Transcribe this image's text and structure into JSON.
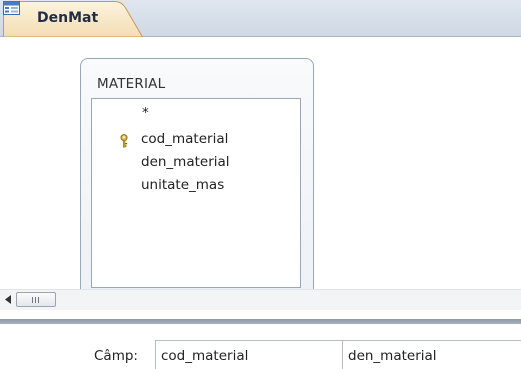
{
  "tab": {
    "label": "DenMat",
    "icon": "query-design-icon"
  },
  "field_list": {
    "title": "MATERIAL",
    "fields": [
      {
        "name": "*",
        "primary_key": false
      },
      {
        "name": "cod_material",
        "primary_key": true
      },
      {
        "name": "den_material",
        "primary_key": false
      },
      {
        "name": "unitate_mas",
        "primary_key": false
      }
    ]
  },
  "grid": {
    "row_label": "Câmp:",
    "columns": [
      "cod_material",
      "den_material"
    ]
  },
  "colors": {
    "tab_fill": "#f6e6c8",
    "tab_border": "#d1a25e",
    "accent": "#d9862b"
  }
}
